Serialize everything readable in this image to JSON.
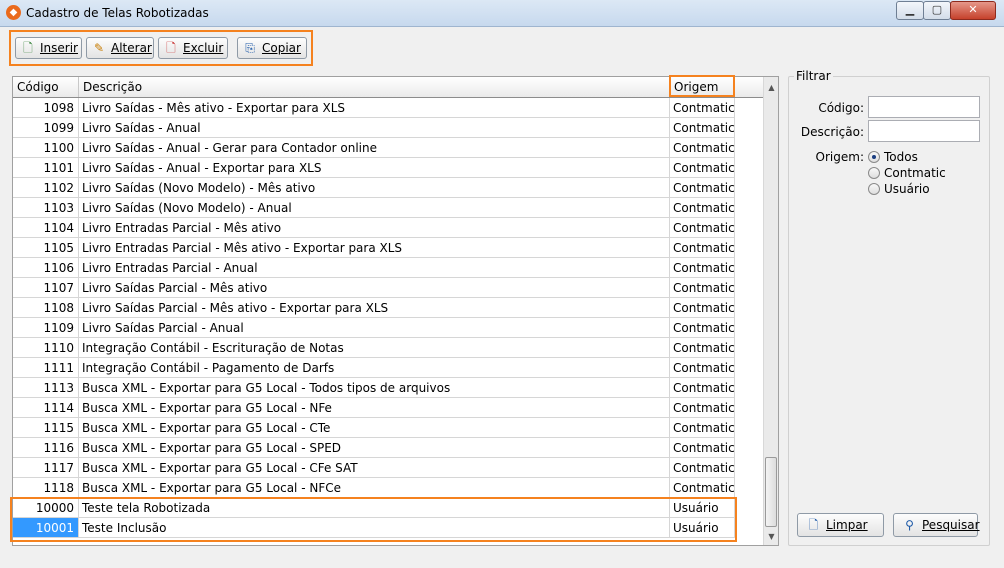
{
  "window": {
    "title": "Cadastro de Telas Robotizadas",
    "controls": {
      "minimize": "▁",
      "maximize": "▢",
      "close": "✕"
    }
  },
  "toolbar": {
    "buttons": [
      {
        "label": "Inserir",
        "icon": "document-add-icon"
      },
      {
        "label": "Alterar",
        "icon": "document-edit-icon"
      },
      {
        "label": "Excluir",
        "icon": "document-delete-icon"
      },
      {
        "label": "Copiar",
        "icon": "document-copy-icon"
      }
    ]
  },
  "grid": {
    "columns": [
      "Código",
      "Descrição",
      "Origem"
    ],
    "rows": [
      {
        "code": "1098",
        "desc": "Livro Saídas - Mês ativo - Exportar para XLS",
        "origin": "Contmatic"
      },
      {
        "code": "1099",
        "desc": "Livro Saídas - Anual",
        "origin": "Contmatic"
      },
      {
        "code": "1100",
        "desc": "Livro Saídas - Anual - Gerar para Contador online",
        "origin": "Contmatic"
      },
      {
        "code": "1101",
        "desc": "Livro Saídas - Anual - Exportar para XLS",
        "origin": "Contmatic"
      },
      {
        "code": "1102",
        "desc": "Livro Saídas (Novo Modelo) - Mês ativo",
        "origin": "Contmatic"
      },
      {
        "code": "1103",
        "desc": "Livro Saídas (Novo Modelo) - Anual",
        "origin": "Contmatic"
      },
      {
        "code": "1104",
        "desc": "Livro Entradas Parcial - Mês ativo",
        "origin": "Contmatic"
      },
      {
        "code": "1105",
        "desc": "Livro Entradas Parcial - Mês ativo - Exportar para XLS",
        "origin": "Contmatic"
      },
      {
        "code": "1106",
        "desc": "Livro Entradas Parcial - Anual",
        "origin": "Contmatic"
      },
      {
        "code": "1107",
        "desc": "Livro Saídas Parcial - Mês ativo",
        "origin": "Contmatic"
      },
      {
        "code": "1108",
        "desc": "Livro Saídas Parcial - Mês ativo - Exportar para XLS",
        "origin": "Contmatic"
      },
      {
        "code": "1109",
        "desc": "Livro Saídas Parcial - Anual",
        "origin": "Contmatic"
      },
      {
        "code": "1110",
        "desc": "Integração Contábil - Escrituração de Notas",
        "origin": "Contmatic"
      },
      {
        "code": "1111",
        "desc": "Integração Contábil - Pagamento de Darfs",
        "origin": "Contmatic"
      },
      {
        "code": "1113",
        "desc": "Busca XML - Exportar para G5 Local - Todos tipos de arquivos",
        "origin": "Contmatic"
      },
      {
        "code": "1114",
        "desc": "Busca XML - Exportar para G5 Local - NFe",
        "origin": "Contmatic"
      },
      {
        "code": "1115",
        "desc": "Busca XML - Exportar para G5 Local - CTe",
        "origin": "Contmatic"
      },
      {
        "code": "1116",
        "desc": "Busca XML - Exportar para G5 Local - SPED",
        "origin": "Contmatic"
      },
      {
        "code": "1117",
        "desc": "Busca XML - Exportar para G5 Local - CFe SAT",
        "origin": "Contmatic"
      },
      {
        "code": "1118",
        "desc": "Busca XML - Exportar para G5 Local - NFCe",
        "origin": "Contmatic"
      },
      {
        "code": "10000",
        "desc": "Teste tela Robotizada",
        "origin": "Usuário"
      },
      {
        "code": "10001",
        "desc": "Teste Inclusão",
        "origin": "Usuário"
      }
    ]
  },
  "filter": {
    "title": "Filtrar",
    "code_label": "Código:",
    "code_value": "",
    "desc_label": "Descrição:",
    "desc_value": "",
    "origin_label": "Origem:",
    "origin_options": [
      "Todos",
      "Contmatic",
      "Usuário"
    ],
    "origin_selected": "Todos",
    "clear_label": "Limpar",
    "search_label": "Pesquisar"
  },
  "colors": {
    "highlight": "#f5821f",
    "selection": "#3399ff"
  }
}
